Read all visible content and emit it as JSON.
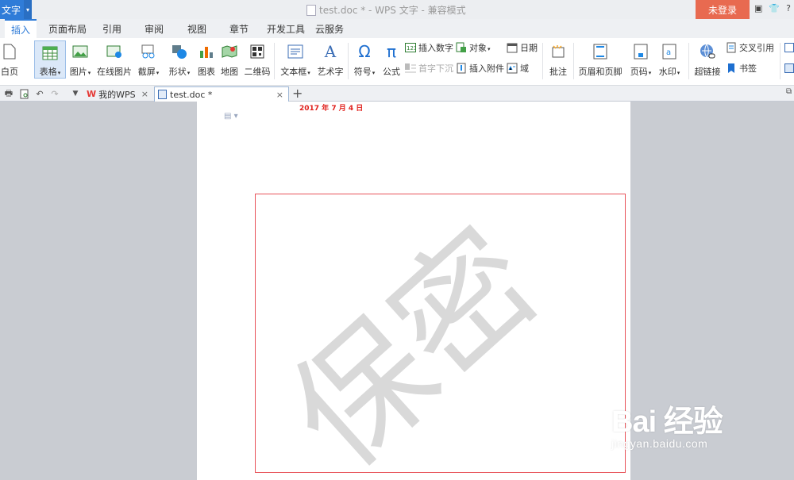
{
  "titlebar": {
    "app_label": "文字",
    "doc_title": "test.doc * - WPS 文字 - 兼容模式",
    "login_label": "未登录",
    "help_glyph": "?"
  },
  "tabs": [
    "插入",
    "页面布局",
    "引用",
    "审阅",
    "视图",
    "章节",
    "开发工具",
    "云服务"
  ],
  "ribbon": {
    "blank_page": "白页",
    "table": "表格",
    "picture": "图片",
    "online_picture": "在线图片",
    "screenshot": "截屏",
    "shape": "形状",
    "chart": "图表",
    "map": "地图",
    "qrcode": "二维码",
    "textbox": "文本框",
    "art_text": "艺术字",
    "symbol": "符号",
    "formula": "公式",
    "insert_number": "插入数字",
    "drop_cap": "首字下沉",
    "object": "对象",
    "attachment": "插入附件",
    "date": "日期",
    "field": "域",
    "comment": "批注",
    "header_footer": "页眉和页脚",
    "page_number": "页码",
    "watermark": "水印",
    "hyperlink": "超链接",
    "cross_ref": "交叉引用",
    "bookmark": "书签"
  },
  "doc_tabs": [
    {
      "label": "我的WPS",
      "close": "×"
    },
    {
      "label": "test.doc *",
      "close": "×"
    }
  ],
  "document": {
    "header_date": "2017 年 7 月 4 日",
    "watermark_text": "保密"
  },
  "overlay": {
    "brand": "Bai  经验",
    "url": "jingyan.baidu.com"
  },
  "colors": {
    "accent": "#2f7cd8",
    "login": "#e86a50",
    "header_date": "#e0201c",
    "frame": "#e8545a",
    "watermark": "#d9d9d9"
  }
}
